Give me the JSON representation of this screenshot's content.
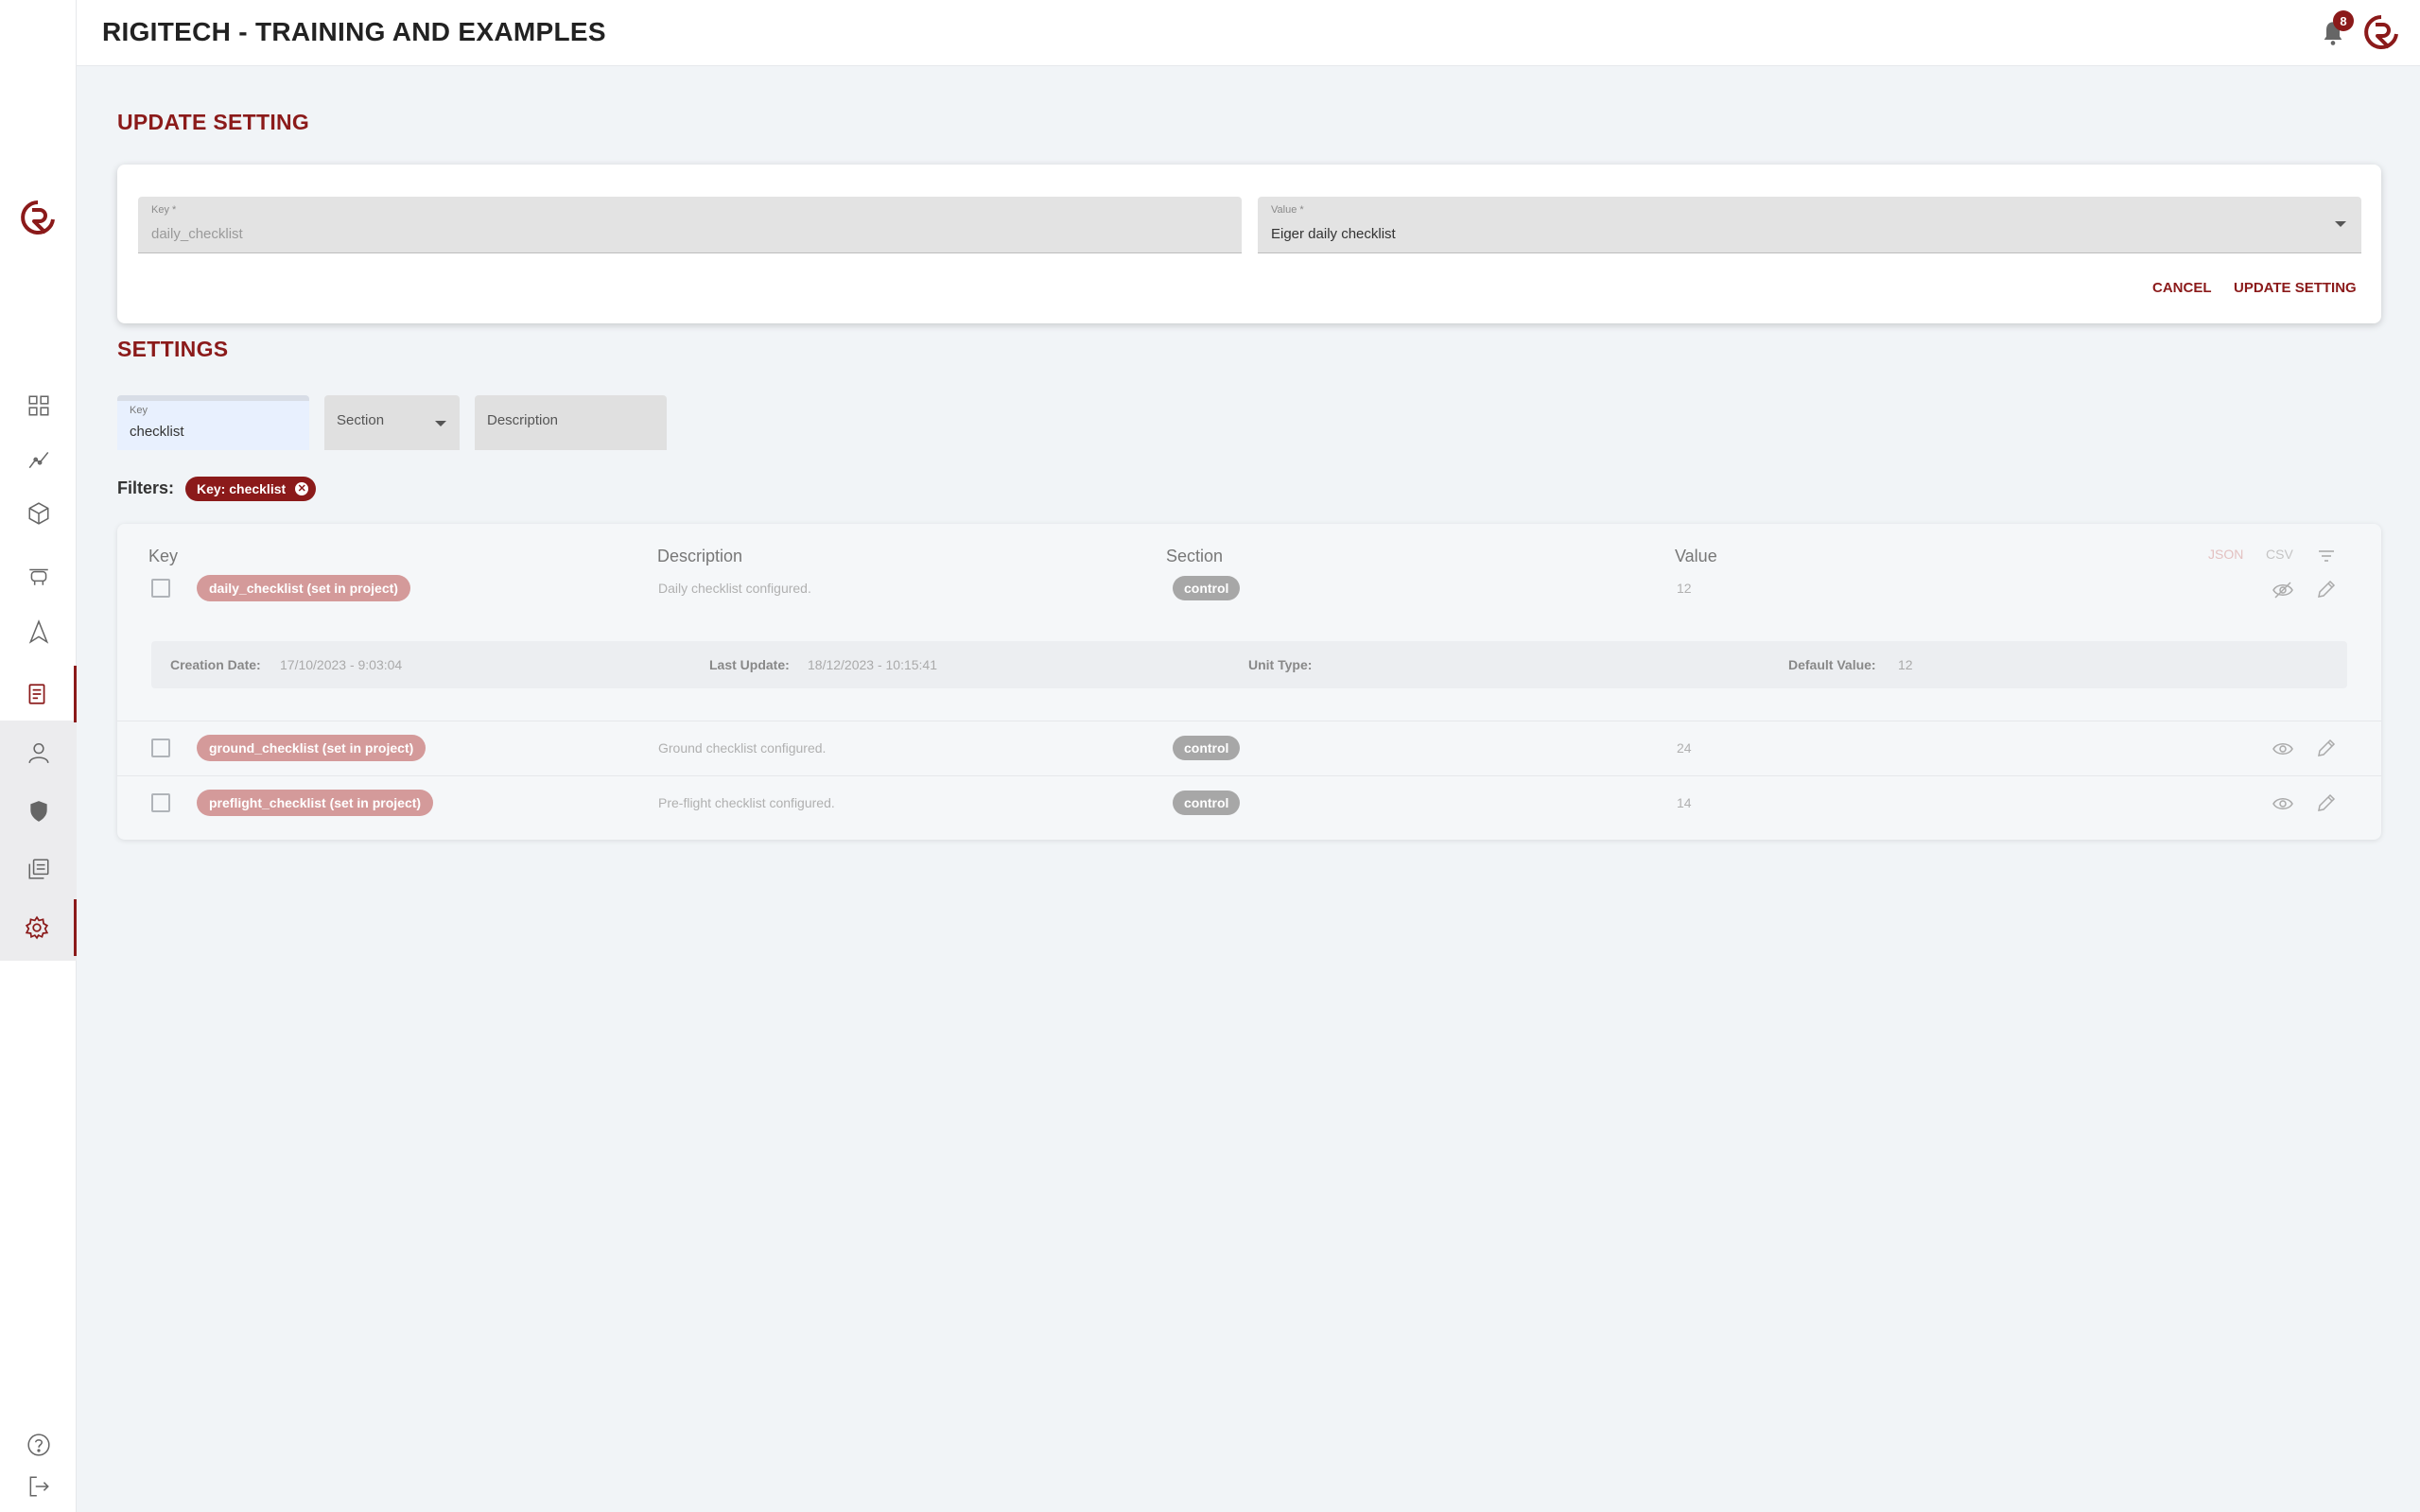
{
  "app": {
    "title": "RIGITECH - TRAINING AND EXAMPLES",
    "notification_count": "8"
  },
  "colors": {
    "brand": "#8b1a1a",
    "pill": "#d49a9a",
    "section_badge": "#a7a7a7"
  },
  "sidebar": {
    "items": [
      {
        "name": "dashboard",
        "icon": "grid-icon"
      },
      {
        "name": "analytics",
        "icon": "chart-line-icon"
      },
      {
        "name": "products",
        "icon": "cube-icon"
      },
      {
        "name": "drones",
        "icon": "drone-icon"
      },
      {
        "name": "navigation",
        "icon": "arrow-icon"
      },
      {
        "name": "documents",
        "icon": "document-icon"
      },
      {
        "name": "users",
        "icon": "user-icon"
      },
      {
        "name": "security",
        "icon": "shield-icon"
      },
      {
        "name": "library",
        "icon": "library-icon"
      },
      {
        "name": "settings",
        "icon": "gear-icon"
      },
      {
        "name": "help",
        "icon": "help-icon"
      },
      {
        "name": "logout",
        "icon": "logout-icon"
      }
    ]
  },
  "update": {
    "title": "UPDATE SETTING",
    "key_label": "Key *",
    "key_value": "daily_checklist",
    "value_label": "Value *",
    "value_value": "Eiger daily checklist",
    "cancel_label": "CANCEL",
    "update_label": "UPDATE SETTING"
  },
  "settings": {
    "title": "SETTINGS",
    "filter_key_label": "Key",
    "filter_key_value": "checklist",
    "filter_section_placeholder": "Section",
    "filter_description_placeholder": "Description",
    "filters_label": "Filters:",
    "active_filter": "Key: checklist",
    "active_filter_remove": "✕"
  },
  "table": {
    "headers": {
      "key": "Key",
      "description": "Description",
      "section": "Section",
      "value": "Value"
    },
    "tools": {
      "json": "JSON",
      "csv": "CSV"
    },
    "rows": [
      {
        "key": "daily_checklist (set in project)",
        "description": "Daily checklist configured.",
        "section": "control",
        "value": "12"
      },
      {
        "key": "ground_checklist (set in project)",
        "description": "Ground checklist configured.",
        "section": "control",
        "value": "24"
      },
      {
        "key": "preflight_checklist (set in project)",
        "description": "Pre-flight checklist configured.",
        "section": "control",
        "value": "14"
      }
    ],
    "detail": {
      "creation_label": "Creation Date:",
      "creation_value": "17/10/2023 - 9:03:04",
      "update_label": "Last Update:",
      "update_value": "18/12/2023 - 10:15:41",
      "unit_label": "Unit Type:",
      "unit_value": "",
      "default_label": "Default Value:",
      "default_value": "12"
    }
  }
}
